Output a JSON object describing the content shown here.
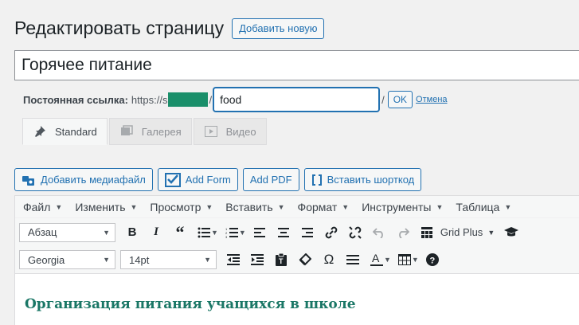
{
  "header": {
    "title": "Редактировать страницу",
    "add_new_label": "Добавить новую"
  },
  "post_title": {
    "value": "Горячее питание"
  },
  "permalink": {
    "label": "Постоянная ссылка:",
    "url_prefix": "https://s",
    "slug": "food",
    "ok_label": "OK",
    "cancel_label": "Отмена"
  },
  "format_tabs": [
    {
      "label": "Standard",
      "icon": "pin-icon"
    },
    {
      "label": "Галерея",
      "icon": "gallery-icon"
    },
    {
      "label": "Видео",
      "icon": "video-icon"
    }
  ],
  "media_buttons": {
    "add_media": "Добавить медиафайл",
    "add_form": "Add Form",
    "add_pdf": "Add PDF",
    "shortcode": "Вставить шорткод"
  },
  "menubar": [
    "Файл",
    "Изменить",
    "Просмотр",
    "Вставить",
    "Формат",
    "Инструменты",
    "Таблица"
  ],
  "toolbar": {
    "paragraph_format": "Абзац",
    "grid_plus": "Grid Plus",
    "font_family": "Georgia",
    "font_size": "14pt"
  },
  "content": {
    "heading": "Организация питания учащихся в школе"
  },
  "colors": {
    "accent": "#2271b1",
    "heading": "#1a7766",
    "mask": "#1a8f6a"
  }
}
